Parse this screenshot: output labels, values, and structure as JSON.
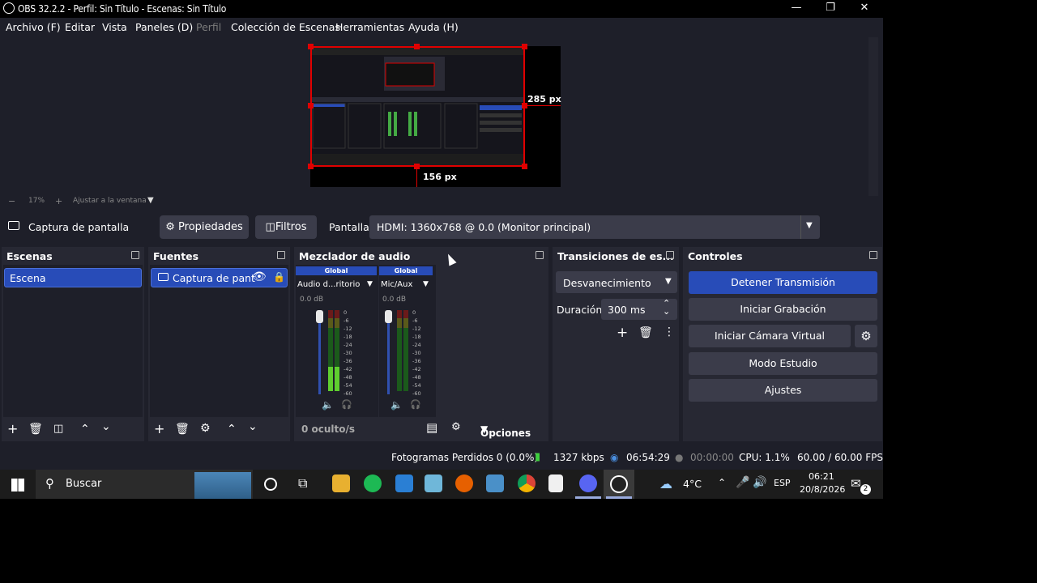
{
  "window": {
    "title": "OBS 32.2.2 - Perfil: Sin Título - Escenas: Sin Título"
  },
  "menu": [
    "Archivo (F)",
    "Editar",
    "Vista",
    "Paneles (D)",
    "Perfil",
    "Colección de Escenas",
    "Herramientas",
    "Ayuda (H)"
  ],
  "preview": {
    "width_label": "285 px",
    "height_label": "156 px",
    "zoom": "17%",
    "zoom_fit": "Ajustar a la ventana"
  },
  "source_bar": {
    "source_name": "Captura de pantalla",
    "properties": "Propiedades",
    "filters": "Filtros",
    "screen_label": "Pantalla",
    "screen_value": "HDMI: 1360x768 @ 0.0 (Monitor principal)"
  },
  "scenes": {
    "title": "Escenas",
    "items": [
      "Escena"
    ]
  },
  "sources": {
    "title": "Fuentes",
    "items": [
      "Captura de pant"
    ]
  },
  "mixer": {
    "title": "Mezclador de audio",
    "channels": [
      {
        "tag": "Global",
        "name": "Audio d...ritorio",
        "db": "0.0 dB"
      },
      {
        "tag": "Global",
        "name": "Mic/Aux",
        "db": "0.0 dB"
      }
    ],
    "scale": [
      "0",
      "-6",
      "-12",
      "-18",
      "-24",
      "-30",
      "-36",
      "-42",
      "-48",
      "-54",
      "-60"
    ],
    "hidden": "0 oculto/s",
    "options": "Opciones"
  },
  "transitions": {
    "title": "Transiciones de es...",
    "selected": "Desvanecimiento",
    "duration_label": "Duración",
    "duration_value": "300 ms"
  },
  "controls": {
    "title": "Controles",
    "stop_stream": "Detener Transmisión",
    "start_rec": "Iniciar Grabación",
    "virtual_cam": "Iniciar Cámara Virtual",
    "studio": "Modo Estudio",
    "settings": "Ajustes",
    "accent": "#284cb8"
  },
  "status": {
    "dropped": "Fotogramas Perdidos 0 (0.0%)",
    "bitrate": "1327 kbps",
    "stream_time": "06:54:29",
    "rec_time": "00:00:00",
    "cpu": "CPU: 1.1%",
    "fps": "60.00 / 60.00 FPS"
  },
  "taskbar": {
    "search": "Buscar",
    "weather": "4°C",
    "lang": "ESP",
    "time": "06:21",
    "date": "20/8/2026",
    "notifications": "2"
  }
}
